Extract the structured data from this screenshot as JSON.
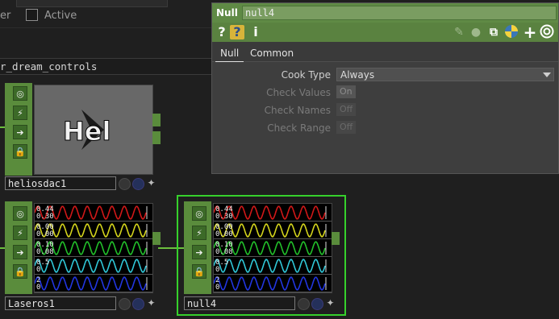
{
  "topbar": {
    "partial_label": "er",
    "active_label": "Active",
    "active_checked": false
  },
  "network": {
    "path": "r_dream_controls"
  },
  "nodes": [
    {
      "id": "heliosdac1",
      "name": "heliosdac1",
      "thumb_text": "Hel"
    },
    {
      "id": "laseros1",
      "name": "Laseros1",
      "channels": [
        {
          "color": "#d01818",
          "v1": "0.44",
          "v2": "0.30"
        },
        {
          "color": "#d4d41c",
          "v1": "0.00",
          "v2": "0.00"
        },
        {
          "color": "#22c02a",
          "v1": "0.10",
          "v2": "0.08"
        },
        {
          "color": "#30c8d8",
          "v1": "0.5",
          "v2": "0"
        },
        {
          "color": "#2236e0",
          "v1": "2",
          "v2": "0"
        }
      ]
    },
    {
      "id": "null4",
      "name": "null4",
      "channels": [
        {
          "color": "#d01818",
          "v1": "0.44",
          "v2": "0.30"
        },
        {
          "color": "#d4d41c",
          "v1": "0.00",
          "v2": "0.00"
        },
        {
          "color": "#22c02a",
          "v1": "0.10",
          "v2": "0.08"
        },
        {
          "color": "#30c8d8",
          "v1": "0.5",
          "v2": "0"
        },
        {
          "color": "#2236e0",
          "v1": "2",
          "v2": "0"
        }
      ]
    }
  ],
  "panel": {
    "op_type": "Null",
    "op_name": "null4",
    "toolbar_icons": [
      "help-icon",
      "python-help-icon",
      "info-icon",
      "edit-icon",
      "comment-icon",
      "clone-icon",
      "python-icon",
      "add-icon",
      "viewer-icon"
    ],
    "tabs": [
      "Null",
      "Common"
    ],
    "active_tab": "Null",
    "params": [
      {
        "label": "Cook Type",
        "kind": "menu",
        "value": "Always",
        "enabled": true
      },
      {
        "label": "Check Values",
        "kind": "toggle",
        "value": "On",
        "enabled": false
      },
      {
        "label": "Check Names",
        "kind": "toggle",
        "value": "Off",
        "enabled": false
      },
      {
        "label": "Check Range",
        "kind": "toggle",
        "value": "Off",
        "enabled": false
      }
    ]
  },
  "colors": {
    "op_green": "#5a8c3c",
    "selection": "#36d12c",
    "panel_header": "#5f8a45"
  }
}
